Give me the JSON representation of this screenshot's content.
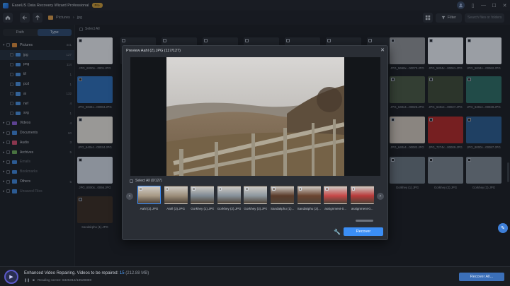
{
  "app": {
    "title": "EaseUS Data Recovery Wizard Professional",
    "badge": "Pro",
    "window_controls": [
      "▯",
      "—",
      "☐",
      "✕"
    ]
  },
  "toolbar": {
    "breadcrumb": [
      "Pictures",
      "jpg"
    ],
    "filter_label": "Filter",
    "search_placeholder": "Search files or folders"
  },
  "sidebar": {
    "tabs": [
      "Path",
      "Type"
    ],
    "active_tab": "Type",
    "items": [
      {
        "label": "Pictures",
        "count": "441",
        "level": 0,
        "expanded": true,
        "icon_color": "#d98b3c"
      },
      {
        "label": "jpg",
        "count": "127",
        "level": 1,
        "active": true,
        "icon_color": "#4a8fdc"
      },
      {
        "label": "png",
        "count": "114",
        "level": 1,
        "icon_color": "#4a8fdc"
      },
      {
        "label": "tif",
        "count": "1",
        "level": 1,
        "icon_color": "#4a8fdc"
      },
      {
        "label": "pcd",
        "count": "1",
        "level": 1,
        "icon_color": "#4a8fdc"
      },
      {
        "label": "ai",
        "count": "132",
        "level": 1,
        "icon_color": "#4a8fdc"
      },
      {
        "label": "nef",
        "count": "4",
        "level": 1,
        "icon_color": "#4a8fdc"
      },
      {
        "label": "svg",
        "count": "1",
        "level": 1,
        "icon_color": "#4a8fdc"
      },
      {
        "label": "Videos",
        "count": "4",
        "level": 0,
        "icon_color": "#8a5fd6"
      },
      {
        "label": "Documents",
        "count": "60",
        "level": 0,
        "icon_color": "#3f86d9"
      },
      {
        "label": "Audio",
        "count": "3",
        "level": 0,
        "icon_color": "#d04e6f"
      },
      {
        "label": "Archives",
        "count": "5",
        "level": 0,
        "icon_color": "#6cab5a"
      },
      {
        "label": "Emails",
        "count": "",
        "level": 0,
        "dim": true,
        "icon_color": "#3f86d9"
      },
      {
        "label": "Bookmarks",
        "count": "",
        "level": 0,
        "dim": true,
        "icon_color": "#3f86d9"
      },
      {
        "label": "Others",
        "count": "5",
        "level": 0,
        "icon_color": "#3f86d9"
      },
      {
        "label": "Unsaved Files",
        "count": "",
        "level": 0,
        "dim": true,
        "icon_color": "#3f86d9"
      }
    ]
  },
  "grid": {
    "select_all_label": "Select All",
    "left_captions": [
      "JPG_6000x...0001.JPG",
      "JPG_5834x...00084.JPG",
      "JPG_640x4...00034.JPG",
      "JPG_8000x...0066.JPG",
      "Sandakphu (1).JPG"
    ],
    "right_captions": [
      [
        "JPG_5668x...00070.JPG",
        "JPG_5834x...00061.JPG",
        "JPG_5834x...00062.JPG"
      ],
      [
        "JPG_640x4...00025.JPG",
        "JPG_640x4...00027.JPG",
        "JPG_640x4...00028.JPG"
      ],
      [
        "JPG_640x4...00082.JPG",
        "JPG_7274x...00009.JPG",
        "JPG_8000x...00087.JPG"
      ],
      [
        "Gorkhey (1).JPG",
        "Gorkhey (2).JPG",
        "Gorkhey (3).JPG"
      ]
    ]
  },
  "modal": {
    "title": "Preview  Aahl (2).JPG (117/127)",
    "select_all_label": "Select All (0/127)",
    "thumbnails": [
      "Aahl (2).JPG",
      "Aahl (3).JPG",
      "Gorkhey (1).JPG",
      "Gorkhey (2).JPG",
      "Gorkhey (3).JPG",
      "Sandakphu (1)...",
      "Sandakphu (2)...",
      "assignment-0...",
      "assignment-0..."
    ],
    "recover_label": "Recover"
  },
  "bottom": {
    "title_prefix": "Enhanced Video Repairing. Videos to be repaired:",
    "count": "15",
    "size": "(212.88 MB)",
    "sub": "Reading sector: 6325312/13529880"
  },
  "recover_all_label": "Recover All..."
}
